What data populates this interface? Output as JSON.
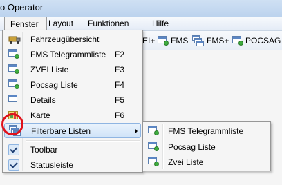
{
  "window": {
    "title": "o Operator"
  },
  "menubar": {
    "items": [
      "Fenster",
      "Layout",
      "Funktionen",
      "Hilfe"
    ]
  },
  "toolbar": {
    "partial_label": "EI+",
    "buttons": [
      "FMS",
      "FMS+",
      "POCSAG"
    ]
  },
  "dropdown": {
    "items": [
      {
        "label": "Fahrzeugübersicht",
        "key": "",
        "icon": "vehicle-icon"
      },
      {
        "label": "FMS Telegrammliste",
        "key": "F2",
        "icon": "window-add-icon"
      },
      {
        "label": "ZVEI Liste",
        "key": "F3",
        "icon": "window-add-icon"
      },
      {
        "label": "Pocsag Liste",
        "key": "F4",
        "icon": "window-add-icon"
      },
      {
        "label": "Details",
        "key": "F5",
        "icon": "window-icon"
      },
      {
        "label": "Karte",
        "key": "F6",
        "icon": "map-icon"
      },
      {
        "label": "Filterbare Listen",
        "key": "",
        "icon": "stacked-windows-icon"
      },
      {
        "label": "Toolbar",
        "key": "",
        "icon": "check-icon"
      },
      {
        "label": "Statusleiste",
        "key": "",
        "icon": "check-icon"
      }
    ]
  },
  "submenu": {
    "items": [
      {
        "label": "FMS Telegrammliste",
        "icon": "window-add-icon"
      },
      {
        "label": "Pocsag Liste",
        "icon": "window-add-icon"
      },
      {
        "label": "Zvei Liste",
        "icon": "window-add-icon"
      }
    ]
  },
  "colors": {
    "highlight": "#cfe3f8",
    "annotation_circle": "#e0121b"
  }
}
